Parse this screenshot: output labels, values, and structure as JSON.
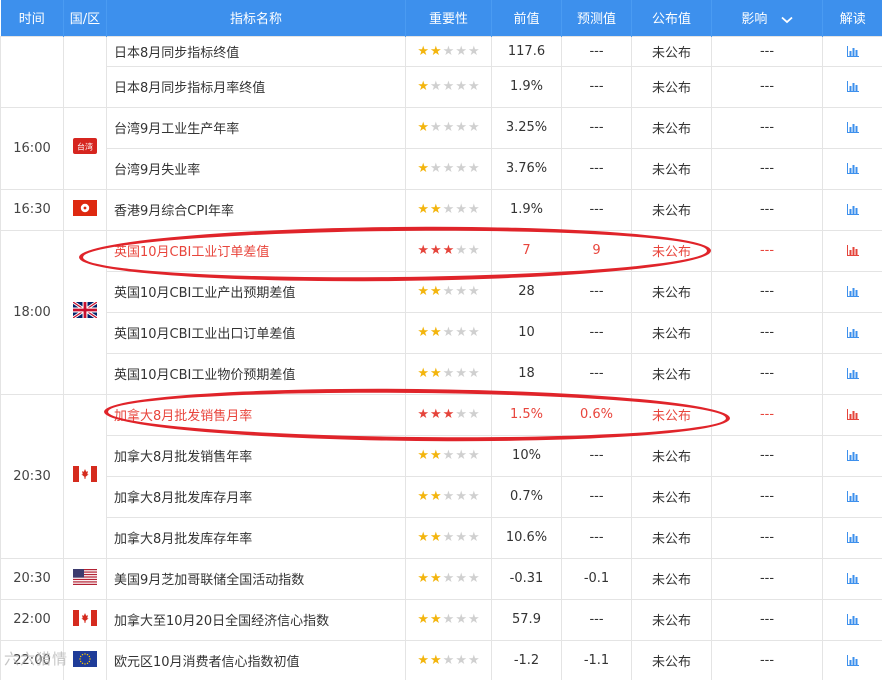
{
  "header": {
    "time": "时间",
    "country": "国/区",
    "indicator": "指标名称",
    "importance": "重要性",
    "previous": "前值",
    "forecast": "预测值",
    "actual": "公布值",
    "impact": "影响",
    "analysis": "解读"
  },
  "groups": [
    {
      "time": "",
      "flag": "jp",
      "flag_label": "",
      "rows": [
        {
          "name": "日本8月同步指标终值",
          "stars": 2,
          "prev": "117.6",
          "fc": "---",
          "act": "未公布",
          "impact": "---",
          "hl": false
        },
        {
          "name": "日本8月同步指标月率终值",
          "stars": 1,
          "prev": "1.9%",
          "fc": "---",
          "act": "未公布",
          "impact": "---",
          "hl": false
        }
      ]
    },
    {
      "time": "16:00",
      "flag": "tw",
      "flag_label": "台湾",
      "rows": [
        {
          "name": "台湾9月工业生产年率",
          "stars": 1,
          "prev": "3.25%",
          "fc": "---",
          "act": "未公布",
          "impact": "---",
          "hl": false
        },
        {
          "name": "台湾9月失业率",
          "stars": 1,
          "prev": "3.76%",
          "fc": "---",
          "act": "未公布",
          "impact": "---",
          "hl": false
        }
      ]
    },
    {
      "time": "16:30",
      "flag": "hk",
      "flag_label": "",
      "rows": [
        {
          "name": "香港9月综合CPI年率",
          "stars": 2,
          "prev": "1.9%",
          "fc": "---",
          "act": "未公布",
          "impact": "---",
          "hl": false
        }
      ]
    },
    {
      "time": "18:00",
      "flag": "uk",
      "flag_label": "",
      "rows": [
        {
          "name": "英国10月CBI工业订单差值",
          "stars": 3,
          "prev": "7",
          "fc": "9",
          "act": "未公布",
          "impact": "---",
          "hl": true
        },
        {
          "name": "英国10月CBI工业产出预期差值",
          "stars": 2,
          "prev": "28",
          "fc": "---",
          "act": "未公布",
          "impact": "---",
          "hl": false
        },
        {
          "name": "英国10月CBI工业出口订单差值",
          "stars": 2,
          "prev": "10",
          "fc": "---",
          "act": "未公布",
          "impact": "---",
          "hl": false
        },
        {
          "name": "英国10月CBI工业物价预期差值",
          "stars": 2,
          "prev": "18",
          "fc": "---",
          "act": "未公布",
          "impact": "---",
          "hl": false
        }
      ]
    },
    {
      "time": "20:30",
      "flag": "ca",
      "flag_label": "",
      "rows": [
        {
          "name": "加拿大8月批发销售月率",
          "stars": 3,
          "prev": "1.5%",
          "fc": "0.6%",
          "act": "未公布",
          "impact": "---",
          "hl": true
        },
        {
          "name": "加拿大8月批发销售年率",
          "stars": 2,
          "prev": "10%",
          "fc": "---",
          "act": "未公布",
          "impact": "---",
          "hl": false
        },
        {
          "name": "加拿大8月批发库存月率",
          "stars": 2,
          "prev": "0.7%",
          "fc": "---",
          "act": "未公布",
          "impact": "---",
          "hl": false
        },
        {
          "name": "加拿大8月批发库存年率",
          "stars": 2,
          "prev": "10.6%",
          "fc": "---",
          "act": "未公布",
          "impact": "---",
          "hl": false
        }
      ]
    },
    {
      "time": "20:30",
      "flag": "us",
      "flag_label": "",
      "rows": [
        {
          "name": "美国9月芝加哥联储全国活动指数",
          "stars": 2,
          "prev": "-0.31",
          "fc": "-0.1",
          "act": "未公布",
          "impact": "---",
          "hl": false
        }
      ]
    },
    {
      "time": "22:00",
      "flag": "ca",
      "flag_label": "",
      "rows": [
        {
          "name": "加拿大至10月20日全国经济信心指数",
          "stars": 2,
          "prev": "57.9",
          "fc": "---",
          "act": "未公布",
          "impact": "---",
          "hl": false
        }
      ]
    },
    {
      "time": "22:00",
      "flag": "eu",
      "flag_label": "",
      "rows": [
        {
          "name": "欧元区10月消费者信心指数初值",
          "stars": 2,
          "prev": "-1.2",
          "fc": "-1.1",
          "act": "未公布",
          "impact": "---",
          "hl": false
        }
      ]
    }
  ],
  "colors": {
    "header_bg": "#3d90ed",
    "highlight": "#e8453c",
    "star": "#f3b50e",
    "link_icon": "#3d90ed"
  },
  "icons": {
    "impact_dropdown": "chevron-down-icon",
    "analysis": "bar-chart-icon",
    "importance": "star-icon"
  },
  "watermark": "六六猎情"
}
